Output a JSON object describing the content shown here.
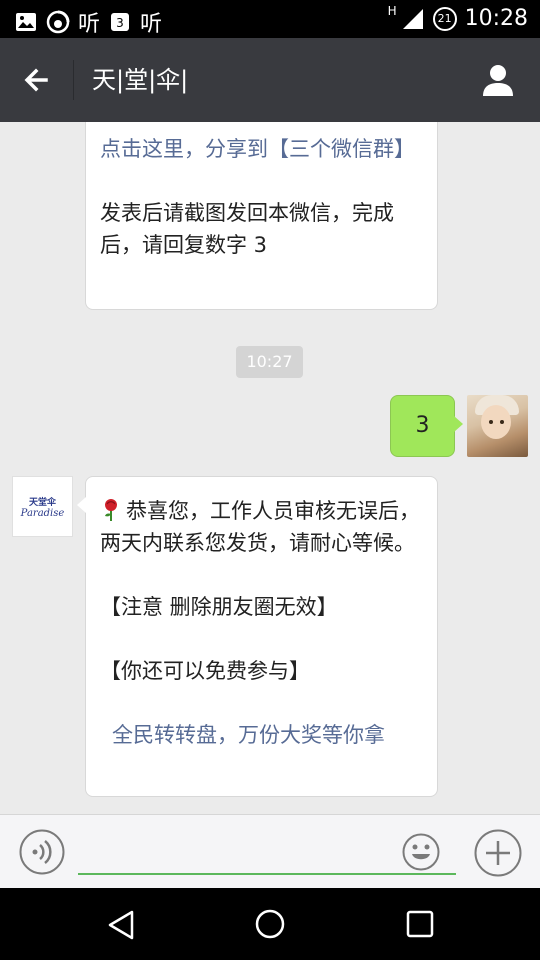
{
  "status_bar": {
    "carrier_glyphs": "听",
    "h_badge": "H",
    "battery_level": "21",
    "time": "10:28"
  },
  "header": {
    "title": "天|堂|伞|"
  },
  "messages": {
    "top_bubble": {
      "link_text": "点击这里，分享到【三个微信群】",
      "text": "发表后请截图发回本微信，完成后，请回复数字 3"
    },
    "timestamp": "10:27",
    "my_reply": "3",
    "brand_avatar": {
      "cn": "天堂伞",
      "en": "Paradise"
    },
    "main_bubble": {
      "line1": "恭喜您，工作人员审核无误后，两天内联系您发货，请耐心等候。",
      "line2": "【注意 删除朋友圈无效】",
      "line3": "【你还可以免费参与】",
      "link_text": "全民转转盘，万份大奖等你拿"
    }
  },
  "input": {
    "value": "",
    "placeholder": ""
  },
  "colors": {
    "titlebar": "#393a3f",
    "my_bubble": "#a0e75a",
    "link": "#576b95",
    "input_underline": "#5cb85c"
  }
}
